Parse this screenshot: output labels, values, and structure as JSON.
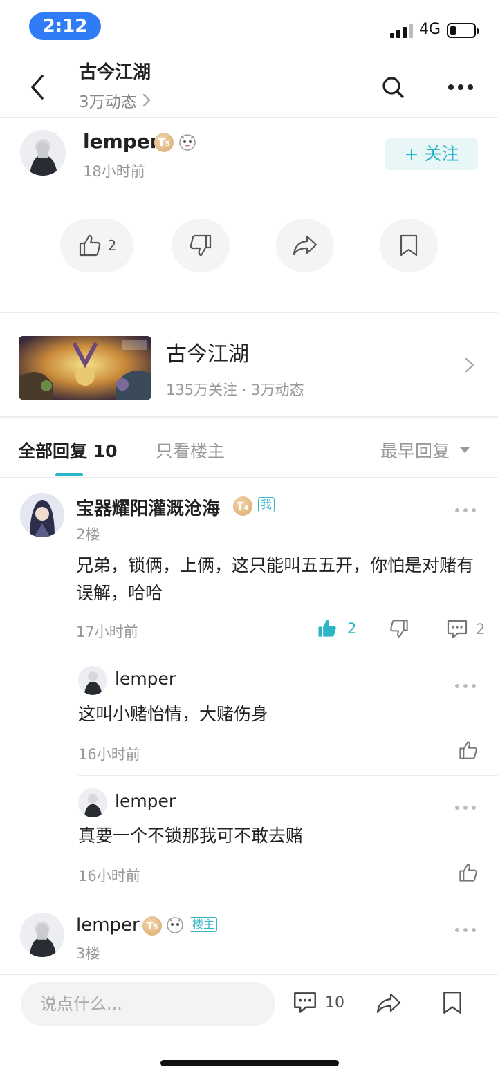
{
  "status_bar": {
    "time": "2:12",
    "network": "4G"
  },
  "header": {
    "title": "古今江湖",
    "subtitle": "3万动态"
  },
  "post": {
    "author": "lemper",
    "author_level": "5",
    "time": "18小时前",
    "follow_label": "+ 关注",
    "like_count": "2"
  },
  "forum": {
    "name": "古今江湖",
    "stats": "135万关注 · 3万动态"
  },
  "tabs": {
    "all_label": "全部回复",
    "all_count": "10",
    "owner_only": "只看楼主",
    "sort_label": "最早回复"
  },
  "comments": [
    {
      "author": "宝器耀阳灌溉沧海",
      "level": "4",
      "tag": "我",
      "floor": "2楼",
      "text": "兄弟，锁俩，上俩，这只能叫五五开，你怕是对赌有误解，哈哈",
      "time": "17小时前",
      "likes": "2",
      "replies_count": "2",
      "replies": [
        {
          "author": "lemper",
          "text": "这叫小赌怡情，大赌伤身",
          "time": "16小时前"
        },
        {
          "author": "lemper",
          "text": "真要一个不锁那我可不敢去赌",
          "time": "16小时前"
        }
      ]
    },
    {
      "author": "lemper",
      "level": "5",
      "tag": "楼主",
      "floor": "3楼"
    }
  ],
  "bottom_bar": {
    "placeholder": "说点什么...",
    "comment_count": "10"
  },
  "colors": {
    "accent": "#2bb5c6",
    "time_pill": "#2f7cf6"
  }
}
